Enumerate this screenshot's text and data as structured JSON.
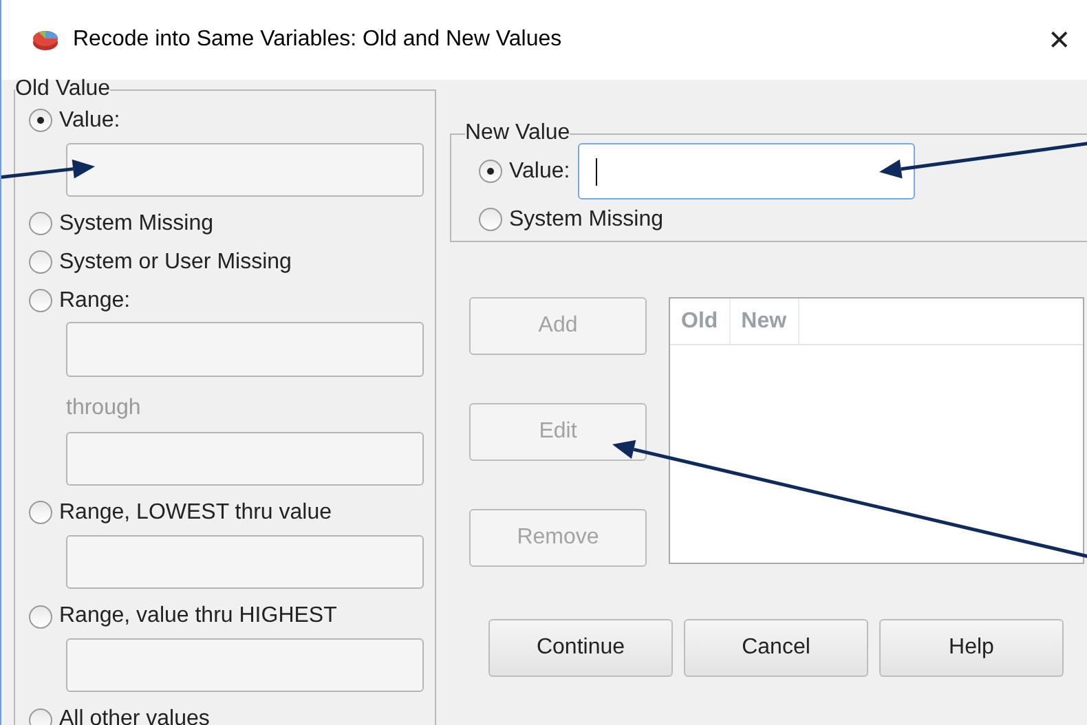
{
  "window": {
    "title": "Recode into Same Variables: Old and New Values",
    "close": "✕"
  },
  "old_value": {
    "title": "Old Value",
    "options": [
      {
        "label": "Value:",
        "selected": true,
        "fields": [
          {
            "kind": "input"
          }
        ]
      },
      {
        "label": "System Missing",
        "selected": false
      },
      {
        "label": "System or User Missing",
        "selected": false
      },
      {
        "label": "Range:",
        "selected": false,
        "fields": [
          {
            "kind": "input"
          },
          {
            "kind": "caption",
            "text": "through",
            "disabled": true
          },
          {
            "kind": "input"
          }
        ]
      },
      {
        "label": "Range, LOWEST thru value",
        "selected": false,
        "fields": [
          {
            "kind": "input"
          }
        ]
      },
      {
        "label": "Range, value thru HIGHEST",
        "selected": false,
        "fields": [
          {
            "kind": "input"
          }
        ]
      },
      {
        "label": "All other values",
        "selected": false
      }
    ]
  },
  "new_value": {
    "title": "New Value",
    "options": [
      {
        "label": "Value:",
        "selected": true,
        "field": {
          "focused": true
        }
      },
      {
        "label": "System Missing",
        "selected": false
      }
    ]
  },
  "list_buttons": [
    {
      "label": "Add",
      "disabled": true
    },
    {
      "label": "Edit",
      "disabled": true
    },
    {
      "label": "Remove",
      "disabled": true
    }
  ],
  "table": {
    "columns": [
      "Old",
      "New"
    ]
  },
  "buttons": [
    {
      "label": "Continue"
    },
    {
      "label": "Cancel"
    },
    {
      "label": "Help"
    }
  ],
  "annotations": [
    {
      "kind": "arrow"
    },
    {
      "kind": "arrow"
    },
    {
      "kind": "arrow"
    }
  ]
}
